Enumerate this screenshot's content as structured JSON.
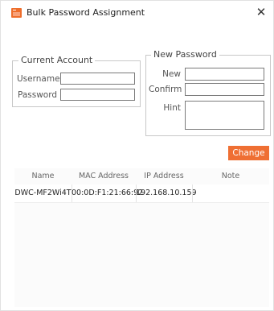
{
  "window": {
    "title": "Bulk Password Assignment"
  },
  "current_account": {
    "legend": "Current Account",
    "username_label": "Username",
    "password_label": "Password",
    "username_value": "",
    "password_value": ""
  },
  "new_password": {
    "legend": "New Password",
    "new_label": "New",
    "confirm_label": "Confirm",
    "hint_label": "Hint",
    "new_value": "",
    "confirm_value": "",
    "hint_value": ""
  },
  "actions": {
    "change_label": "Change"
  },
  "table": {
    "columns": [
      "Name",
      "MAC Address",
      "IP Address",
      "Note"
    ],
    "rows": [
      {
        "name": "DWC-MF2Wi4T",
        "mac": "00:0D:F1:21:66:92",
        "ip": "192.168.10.159",
        "note": ""
      }
    ]
  },
  "colors": {
    "accent": "#ef6f33",
    "icon": "#ee6e2c"
  },
  "icons": {
    "app": "app-icon",
    "close": "close-icon"
  }
}
